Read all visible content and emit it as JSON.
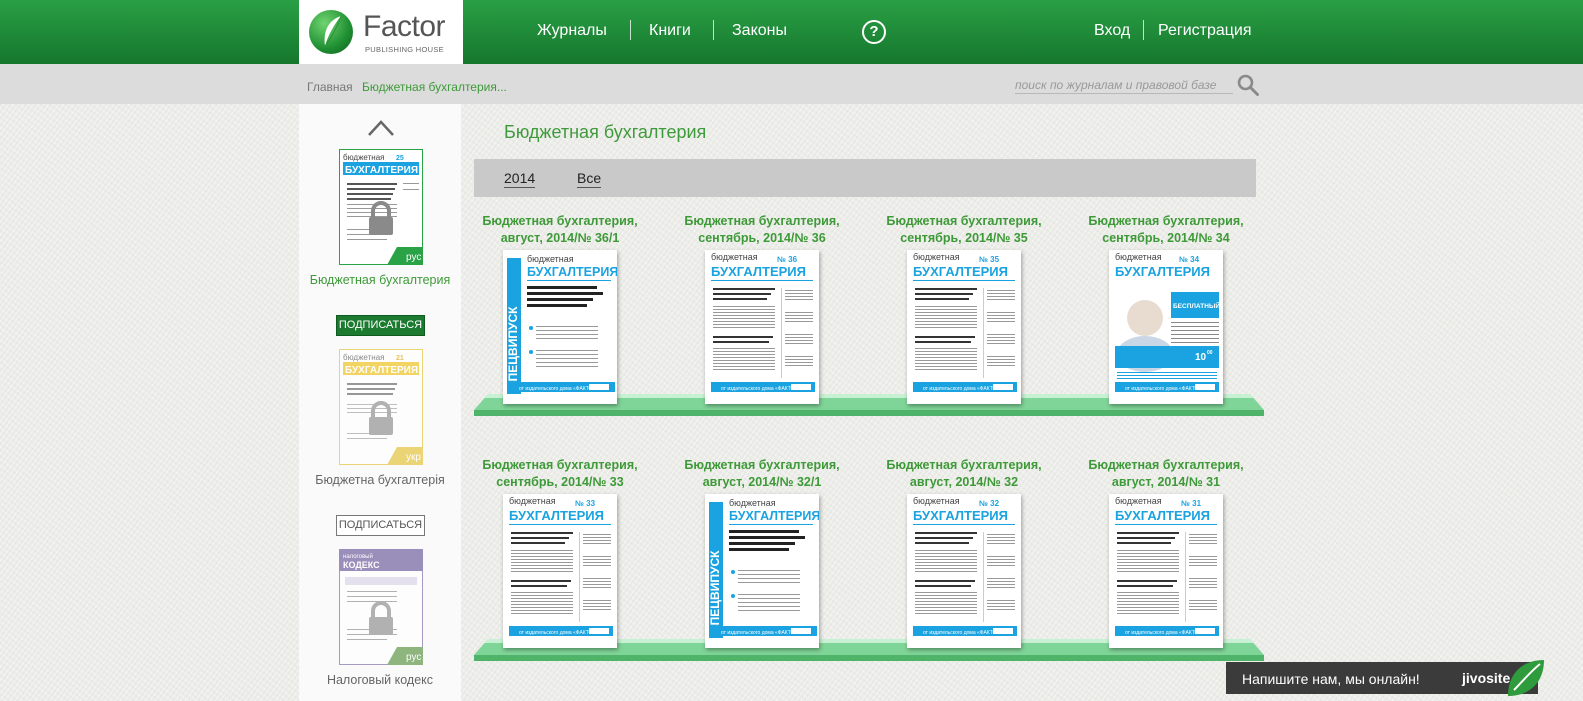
{
  "logo": {
    "word": "Factor",
    "sub": "PUBLISHING HOUSE"
  },
  "nav": {
    "items": [
      "Журналы",
      "Книги",
      "Законы"
    ],
    "login": "Вход",
    "register": "Регистрация",
    "help": "?"
  },
  "breadcrumb": {
    "home": "Главная",
    "current": "Бюджетная бухгалтерия..."
  },
  "search": {
    "placeholder": "поиск по журналам и правовой базе"
  },
  "sidebar": {
    "items": [
      {
        "title": "Бюджетная бухгалтерия",
        "lang": "рус",
        "number": "25",
        "subscribe": "ПОДПИСАТЬСЯ",
        "active": true
      },
      {
        "title": "Бюджетна бухгалтерія",
        "lang": "укр",
        "number": "21",
        "subscribe": "ПОДПИСАТЬСЯ",
        "active": false
      },
      {
        "title": "Налоговый кодекс",
        "lang": "рус",
        "number": "",
        "subscribe": "",
        "active": false
      }
    ]
  },
  "main": {
    "title": "Бюджетная бухгалтерия",
    "filters": [
      "2014",
      "Все"
    ],
    "issues": [
      {
        "line1": "Бюджетная бухгалтерия,",
        "line2": "август, 2014/№ 36/1",
        "kind": "special",
        "special_text": "СПЕЦВИПУСК",
        "headline": "Державні закупівлі: практичні поради від консультанта з питань державних закупівель",
        "number": "36/1"
      },
      {
        "line1": "Бюджетная бухгалтерия,",
        "line2": "сентябрь, 2014/№ 36",
        "kind": "regular",
        "number": "36"
      },
      {
        "line1": "Бюджетная бухгалтерия,",
        "line2": "сентябрь, 2014/№ 35",
        "kind": "regular",
        "number": "35"
      },
      {
        "line1": "Бюджетная бухгалтерия,",
        "line2": "сентябрь, 2014/№ 34",
        "kind": "promo",
        "number": "34",
        "promo1": "БЕСПЛАТНЫЙ",
        "promo2": "10",
        "promo3": "00"
      },
      {
        "line1": "Бюджетная бухгалтерия,",
        "line2": "сентябрь, 2014/№ 33",
        "kind": "regular",
        "number": "33"
      },
      {
        "line1": "Бюджетная бухгалтерия,",
        "line2": "август, 2014/№ 32/1",
        "kind": "special",
        "special_text": "СПЕЦВИПУСК",
        "headline": "Державні закупівлі: відповіді на практичні запитання",
        "number": "32/1"
      },
      {
        "line1": "Бюджетная бухгалтерия,",
        "line2": "август, 2014/№ 32",
        "kind": "regular",
        "number": "32"
      },
      {
        "line1": "Бюджетная бухгалтерия,",
        "line2": "август, 2014/№ 31",
        "kind": "regular",
        "number": "31"
      }
    ],
    "cover_brand_top": "бюджетная",
    "cover_brand_main": "БУХГАЛТЕРИЯ",
    "cover_footer": "от издательского дома «ФАКТОР»"
  },
  "chat": {
    "text": "Напишите нам, мы онлайн!",
    "brand": "jivosite"
  },
  "colors": {
    "green": "#1e8a36",
    "title_green": "#3e9a38",
    "cover_blue": "#1aa3e0"
  }
}
